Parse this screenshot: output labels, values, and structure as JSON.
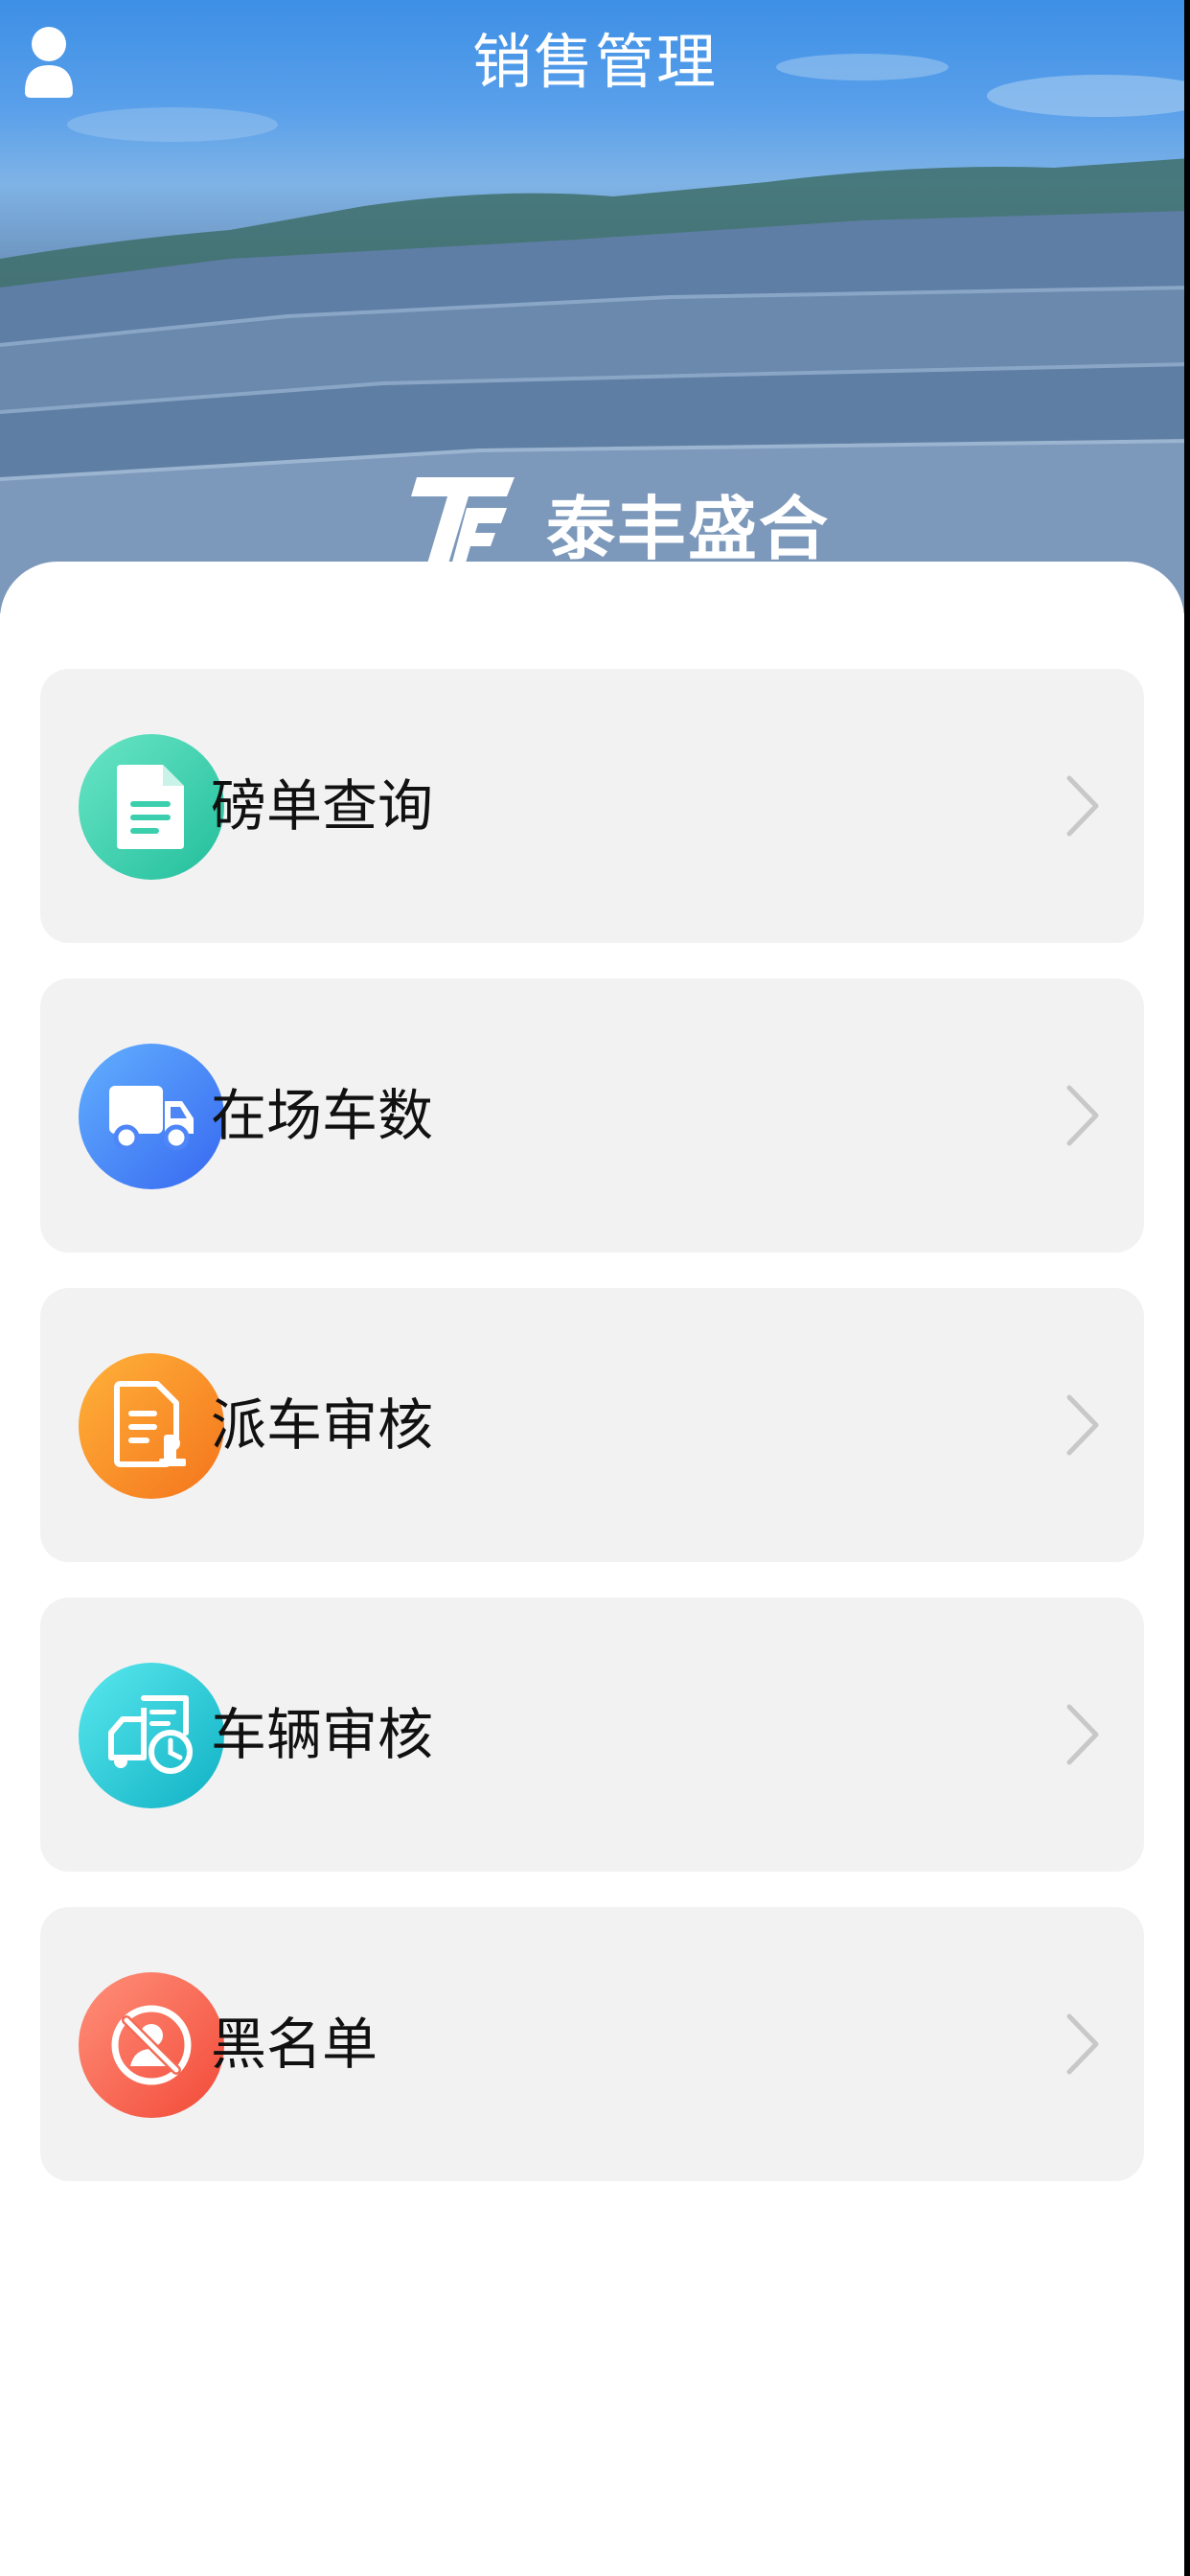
{
  "header": {
    "title": "销售管理",
    "brand_name": "泰丰盛合"
  },
  "menu": {
    "items": [
      {
        "label": "磅单查询",
        "icon": "document-icon",
        "color_from": "#5fe0c0",
        "color_to": "#27c3a0"
      },
      {
        "label": "在场车数",
        "icon": "truck-icon",
        "color_from": "#5ea8ff",
        "color_to": "#3a6ff2"
      },
      {
        "label": "派车审核",
        "icon": "stamp-document-icon",
        "color_from": "#ffad33",
        "color_to": "#f57a1f"
      },
      {
        "label": "车辆审核",
        "icon": "truck-clock-icon",
        "color_from": "#4fe3ea",
        "color_to": "#10b6c7"
      },
      {
        "label": "黑名单",
        "icon": "blocked-user-icon",
        "color_from": "#ff8a6e",
        "color_to": "#f5513f"
      }
    ]
  },
  "colors": {
    "item_background": "#f2f2f2",
    "chevron": "#c8c8c8"
  }
}
